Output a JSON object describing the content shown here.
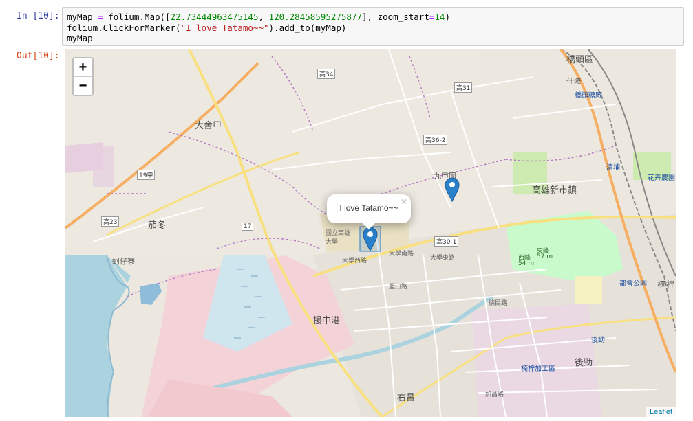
{
  "input_prompt": "In [10]:",
  "output_prompt": "Out[10]:",
  "code": {
    "line1": {
      "var": "myMap",
      "op1": "=",
      "call": "folium.Map([",
      "lat": "22.73444963475145",
      "comma": ",",
      "lng": "120.28458595275877",
      "mid": "], zoom_start",
      "op2": "=",
      "zoom": "14",
      "end": ")"
    },
    "line2": {
      "pre": "folium.ClickForMarker(",
      "str": "\"I love Tatamo~~\"",
      "post": ").add_to(myMap)"
    },
    "line3": "myMap"
  },
  "map": {
    "zoom_in": "+",
    "zoom_out": "−",
    "popup_text": "I love Tatamo~~",
    "popup_close": "×",
    "attribution": "Leaflet",
    "markers": [
      {
        "name": "popup-marker",
        "color": "#2a81cb"
      },
      {
        "name": "second-marker",
        "color": "#2a81cb"
      }
    ],
    "labels": {
      "qiaotou": "橋頭區",
      "renlong": "仕隆",
      "qiaotou_sugar": "橋頭糖廠",
      "kao34": "高34",
      "kao31": "高31",
      "dasheji": "大舍甲",
      "kao36_2": "高36-2",
      "jiujiawei": "九甲圍",
      "r19jia": "19甲",
      "kaohsiung_new_town": "高雄新市鎮",
      "huadan": "花卉農園中心",
      "qingpu": "清埔",
      "kao23": "高23",
      "qiaodong": "茄冬",
      "r17": "17",
      "nuk": "國立高雄大學",
      "kao30_1": "高30-1",
      "kezaiyao": "蚵仔寮",
      "mt1": "東峰",
      "mt1_h": "57 m",
      "mt2": "西峰",
      "mt2_h": "54 m",
      "nanzi": "楠梓",
      "metro_park": "都會公園",
      "houjin": "後勁",
      "nanzi_epz": "楠梓加工區",
      "houjin2": "後勁",
      "yuanzhong": "援中港",
      "youchang": "右昌",
      "daxue_s": "大學南路",
      "daxue_e": "大學東路",
      "daxue_w": "大學西路",
      "deminlu": "德民路",
      "jiachang": "加昌路",
      "lanchang": "藍田路"
    }
  }
}
